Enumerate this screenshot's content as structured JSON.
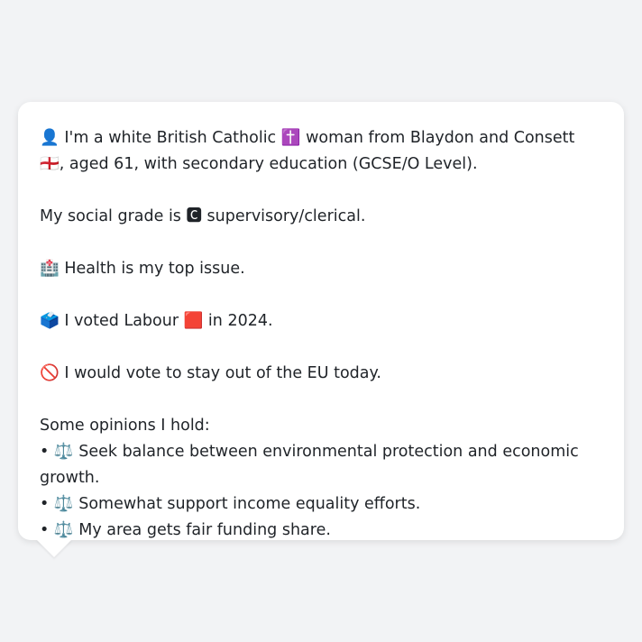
{
  "message": {
    "intro": "👤 I'm a white British Catholic ✝️ woman from Blaydon and Consett 🏴󠁧󠁢󠁥󠁮󠁧󠁿, aged 61, with secondary education (GCSE/O Level).",
    "social_grade": "My social grade is 🅲 supervisory/clerical.",
    "top_issue": "🏥 Health is my top issue.",
    "vote_2024": "🗳️ I voted Labour 🟥 in 2024.",
    "eu_stance": "🚫 I would vote to stay out of the EU today.",
    "opinions_heading": "Some opinions I hold:",
    "opinions": [
      "• ⚖️ Seek balance between environmental protection and economic growth.",
      "• ⚖️ Somewhat support income equality efforts.",
      "• ⚖️ My area gets fair funding share."
    ]
  }
}
